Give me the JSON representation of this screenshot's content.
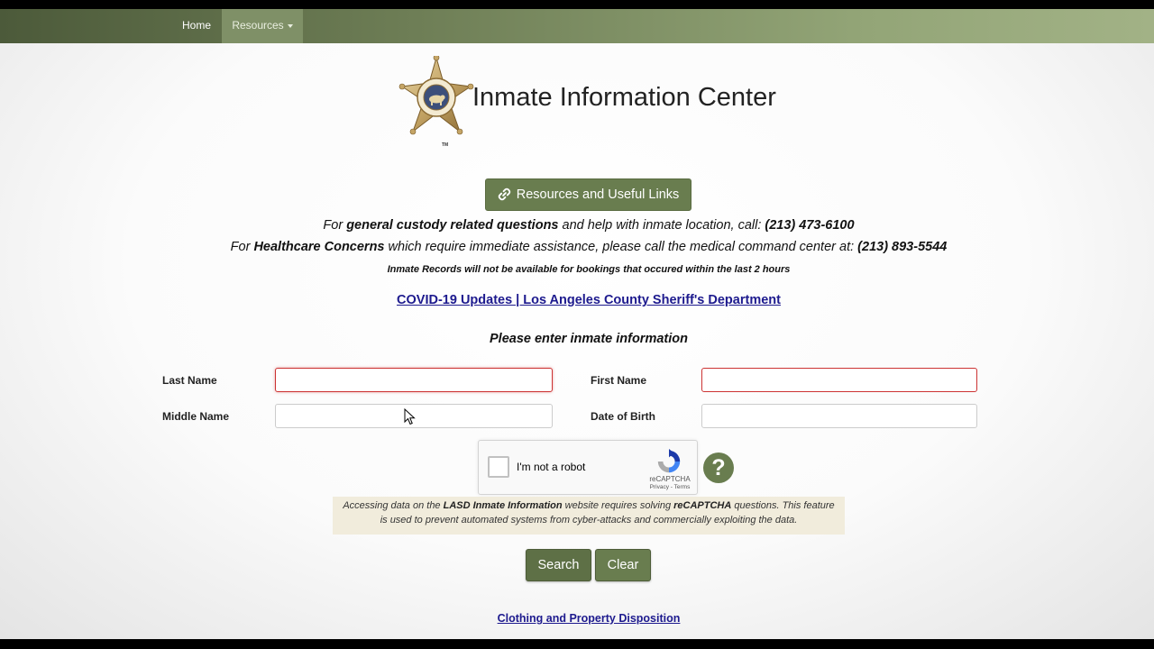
{
  "nav": {
    "home": "Home",
    "resources": "Resources"
  },
  "badge": {
    "top_text": "SHERIFF",
    "bottom_text": "LOS ANGELES COUNTY",
    "tm": "TM"
  },
  "header": {
    "title": "Inmate Information Center"
  },
  "resources_button": {
    "label": "Resources and Useful Links",
    "icon": "link-icon"
  },
  "info": {
    "line1_prefix": "For ",
    "line1_bold": "general custody related questions",
    "line1_middle": " and help with inmate location, call: ",
    "line1_phone": "(213) 473-6100",
    "line2_prefix": "For ",
    "line2_bold": "Healthcare Concerns",
    "line2_middle": " which require immediate assistance, please call the medical command center at: ",
    "line2_phone": "(213) 893-5544",
    "notice": "Inmate Records will not be available for bookings that occured within the last 2 hours",
    "covid_link": "COVID-19 Updates | Los Angeles County Sheriff's Department"
  },
  "form": {
    "heading": "Please enter inmate information",
    "last_name_label": "Last Name",
    "last_name_value": "",
    "first_name_label": "First Name",
    "first_name_value": "",
    "middle_name_label": "Middle Name",
    "middle_name_value": "",
    "dob_label": "Date of Birth",
    "dob_value": ""
  },
  "recaptcha": {
    "label": "I'm not a robot",
    "brand": "reCAPTCHA",
    "privacy": "Privacy",
    "separator": " - ",
    "terms": "Terms"
  },
  "help": {
    "symbol": "?"
  },
  "captcha_note": {
    "part1": "Accessing data on the ",
    "bold1": "LASD Inmate Information",
    "part2": " website requires solving ",
    "bold2": "reCAPTCHA",
    "part3": " questions. This feature",
    "line2": "is used to prevent automated systems from cyber-attacks and commercially exploiting the data."
  },
  "buttons": {
    "search": "Search",
    "clear": "Clear"
  },
  "footer": {
    "clothing_link": "Clothing and Property Disposition"
  },
  "colors": {
    "accent": "#697d4f",
    "navbar_start": "#4c5a3a",
    "navbar_end": "#a2b286",
    "link": "#1d1a8e",
    "required_border": "#cc3333",
    "note_background": "#f1ecdc"
  }
}
